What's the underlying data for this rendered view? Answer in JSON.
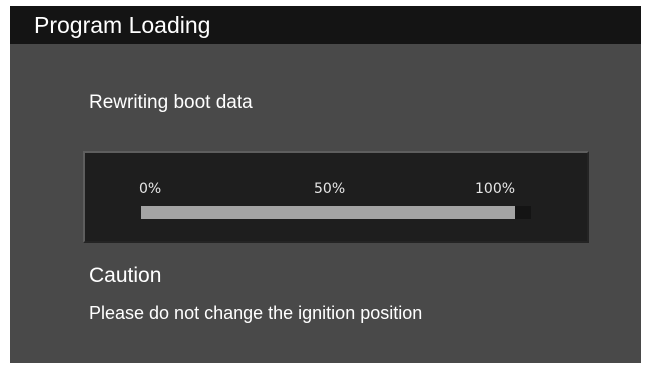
{
  "window": {
    "title": "Program Loading"
  },
  "status": {
    "message": "Rewriting boot data"
  },
  "progress": {
    "fraction": 0.96,
    "tick_labels": [
      "0%",
      "50%",
      "100%"
    ]
  },
  "caution": {
    "title": "Caution",
    "message": "Please do not change the ignition position"
  },
  "colors": {
    "screen_background": "#494949",
    "title_bar_background": "#141414",
    "progress_fill": "#a4a4a4",
    "progress_track": "#141414",
    "text": "#ffffff"
  }
}
